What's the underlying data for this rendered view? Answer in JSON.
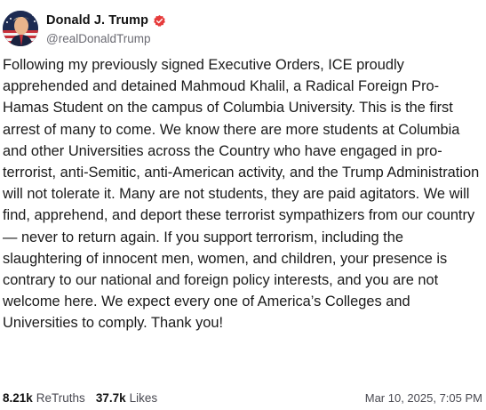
{
  "author": {
    "display_name": "Donald J. Trump",
    "handle": "@realDonaldTrump",
    "verified_icon": "verified-badge-icon",
    "verified_color": "#e63b3b"
  },
  "post": {
    "text": "Following my previously signed Executive Orders, ICE proudly apprehended and detained Mahmoud Khalil, a Radical Foreign Pro-Hamas Student on the campus of Columbia University. This is the first arrest of many to come. We know there are more students at Columbia and other Universities across the Country who have engaged in pro-terrorist, anti-Semitic, anti-American activity, and the Trump Administration will not tolerate it. Many are not students, they are paid agitators. We will find, apprehend, and deport these terrorist sympathizers from our country — never to return again. If you support terrorism, including the slaughtering of innocent men, women, and children, your presence is contrary to our national and foreign policy interests, and you are not welcome here. We expect every one of America’s Colleges and Universities to comply. Thank you!"
  },
  "stats": {
    "retruths_count": "8.21k",
    "retruths_label": "ReTruths",
    "likes_count": "37.7k",
    "likes_label": "Likes"
  },
  "timestamp": "Mar 10, 2025, 7:05 PM"
}
